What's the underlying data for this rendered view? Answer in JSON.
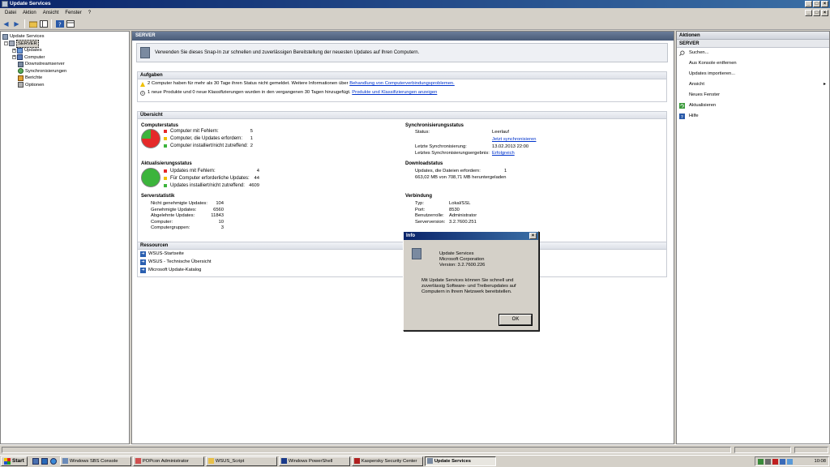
{
  "window": {
    "title": "Update Services",
    "buttons": [
      "_",
      "□",
      "×"
    ]
  },
  "menu": [
    "Datei",
    "Aktion",
    "Ansicht",
    "Fenster",
    "?"
  ],
  "tree": {
    "root": "Update Services",
    "server": "SERVER",
    "items": [
      "Updates",
      "Computer",
      "Downstreamserver",
      "Synchronisierungen",
      "Berichte",
      "Optionen"
    ]
  },
  "main": {
    "header": "SERVER",
    "banner": "Verwenden Sie dieses Snap-In zur schnellen und zuverlässigen Bereitstellung der neuesten Updates auf Ihren Computern.",
    "tasks": {
      "title": "Aufgaben",
      "row1_text": "2 Computer haben für mehr als 30 Tage ihren Status nicht gemeldet. Weitere Informationen über",
      "row1_link": "Behandlung von Computerverbindungsproblemen.",
      "row2_text": "1 neue Produkte und 0 neue Klassifizierungen wurden in den vergangenen 30 Tagen hinzugefügt.",
      "row2_link": "Produkte und Klassifizierungen anzeigen"
    },
    "overview": {
      "title": "Übersicht",
      "computer_status": {
        "title": "Computerstatus",
        "rows": [
          {
            "label": "Computer mit Fehlern:",
            "value": "5"
          },
          {
            "label": "Computer, die Updates erfordern:",
            "value": "1"
          },
          {
            "label": "Computer installiert/nicht zutreffend:",
            "value": "2"
          }
        ]
      },
      "update_status": {
        "title": "Aktualisierungsstatus",
        "rows": [
          {
            "label": "Updates mit Fehlern:",
            "value": "4"
          },
          {
            "label": "Für Computer erforderliche Updates:",
            "value": "44"
          },
          {
            "label": "Updates installiert/nicht zutreffend:",
            "value": "4609"
          }
        ]
      },
      "server_stats": {
        "title": "Serverstatistik",
        "rows": [
          {
            "label": "Nicht genehmigte Updates:",
            "value": "104"
          },
          {
            "label": "Genehmigte Updates:",
            "value": "6560"
          },
          {
            "label": "Abgelehnte Updates:",
            "value": "11843"
          },
          {
            "label": "Computer:",
            "value": "10"
          },
          {
            "label": "Computergruppen:",
            "value": "3"
          }
        ]
      },
      "sync_status": {
        "title": "Synchronisierungsstatus",
        "status_label": "Status:",
        "status_value": "Leerlauf",
        "sync_now_link": "Jetzt synchronisieren",
        "last_sync_label": "Letzte Synchronisierung:",
        "last_sync_value": "13.02.2013 22:00",
        "last_result_label": "Letztes Synchronisierungsergebnis:",
        "last_result_value": "Erfolgreich"
      },
      "download_status": {
        "title": "Downloadstatus",
        "row1_label": "Updates, die Dateien erfordern:",
        "row1_value": "1",
        "row2": "663,02 MB von 708,71 MB heruntergeladen"
      },
      "connection": {
        "title": "Verbindung",
        "rows": [
          {
            "label": "Typ:",
            "value": "Lokal/SSL"
          },
          {
            "label": "Port:",
            "value": "8530"
          },
          {
            "label": "Benutzerrolle:",
            "value": "Administrator"
          },
          {
            "label": "Serverversion:",
            "value": "3.2.7600.251"
          }
        ]
      }
    },
    "resources": {
      "title": "Ressourcen",
      "items": [
        "WSUS-Startseite",
        "WSUS - Technische Übersicht",
        "Microsoft Update-Katalog"
      ]
    }
  },
  "actions": {
    "header": "Aktionen",
    "subheader": "SERVER",
    "items": [
      "Suchen...",
      "Aus Konsole entfernen",
      "Updates importieren...",
      "Ansicht",
      "Neues Fenster",
      "Aktualisieren",
      "Hilfe"
    ]
  },
  "dialog": {
    "title": "Info",
    "close": "×",
    "line1": "Update Services",
    "line2": "Microsoft Corporation",
    "line3": "Version: 3.2.7600.226",
    "description": "Mit Update Services können Sie schnell und zuverlässig Software- und Treiberupdates auf Computern in Ihrem Netzwerk bereitstellen.",
    "ok": "OK"
  },
  "taskbar": {
    "start": "Start",
    "buttons": [
      "Windows SBS Console",
      "POPcon Administrator",
      "WSUS_Script",
      "Windows PowerShell",
      "Kaspersky Security Center",
      "Update Services"
    ],
    "clock": "10:08"
  },
  "colors": {
    "error": "#e52929",
    "warning": "#f0c000",
    "ok": "#3cb43c",
    "link": "#0033cc"
  }
}
